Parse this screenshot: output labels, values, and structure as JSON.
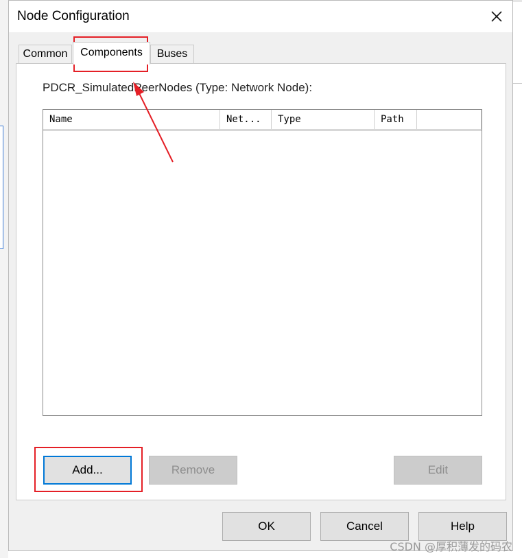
{
  "window": {
    "title": "Node Configuration",
    "close_icon": "close-icon"
  },
  "tabs": [
    {
      "label": "Common",
      "active": false
    },
    {
      "label": "Components",
      "active": true
    },
    {
      "label": "Buses",
      "active": false
    }
  ],
  "panel": {
    "heading": "PDCR_SimulatedPeerNodes (Type: Network Node):",
    "columns": [
      "Name",
      "Net...",
      "Type",
      "Path"
    ],
    "rows": []
  },
  "buttons": {
    "add": "Add...",
    "remove": "Remove",
    "edit": "Edit",
    "ok": "OK",
    "cancel": "Cancel",
    "help": "Help"
  },
  "states": {
    "remove_disabled": true,
    "edit_disabled": true,
    "add_focused": true
  },
  "annotations": {
    "highlight_color": "#e41f26"
  },
  "watermark": "CSDN @厚积薄发的码农"
}
